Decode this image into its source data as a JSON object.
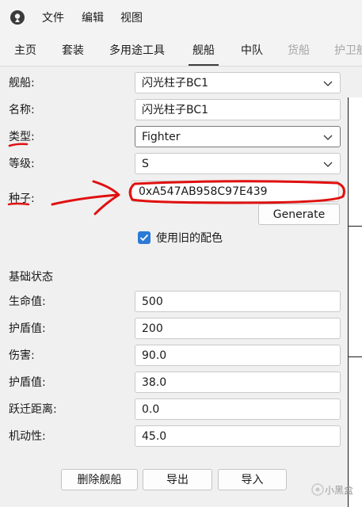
{
  "menu": {
    "items": [
      {
        "label": "文件"
      },
      {
        "label": "编辑"
      },
      {
        "label": "视图"
      }
    ]
  },
  "tabs": [
    {
      "label": "主页",
      "disabled": false
    },
    {
      "label": "套装",
      "disabled": false
    },
    {
      "label": "多用途工具",
      "disabled": false
    },
    {
      "label": "舰船",
      "disabled": false,
      "active": true
    },
    {
      "label": "中队",
      "disabled": false
    },
    {
      "label": "货船",
      "disabled": true
    },
    {
      "label": "护卫舰",
      "disabled": true
    }
  ],
  "form": {
    "ship": {
      "label": "舰船:",
      "value": "闪光柱子BC1"
    },
    "name": {
      "label": "名称:",
      "value": "闪光柱子BC1"
    },
    "type": {
      "label": "类型:",
      "value": "Fighter"
    },
    "class": {
      "label": "等级:",
      "value": "S"
    },
    "seed": {
      "label": "种子:",
      "value": "0xA547AB958C97E439"
    },
    "generate_label": "Generate",
    "old_colors": {
      "label": "使用旧的配色",
      "checked": true
    }
  },
  "base_stats": {
    "heading": "基础状态",
    "rows": [
      {
        "label": "生命值:",
        "value": "500"
      },
      {
        "label": "护盾值:",
        "value": "200"
      },
      {
        "label": "伤害:",
        "value": "90.0"
      },
      {
        "label": "护盾值:",
        "value": "38.0"
      },
      {
        "label": "跃迁距离:",
        "value": "0.0"
      },
      {
        "label": "机动性:",
        "value": "45.0"
      }
    ]
  },
  "actions": {
    "delete_label": "删除舰船",
    "export_label": "导出",
    "import_label": "导入"
  },
  "watermark": {
    "text": "小黑盒"
  },
  "colors": {
    "accent": "#2b7ad6",
    "annotation_red": "#e01010",
    "disabled_text": "#a6a6a6"
  }
}
